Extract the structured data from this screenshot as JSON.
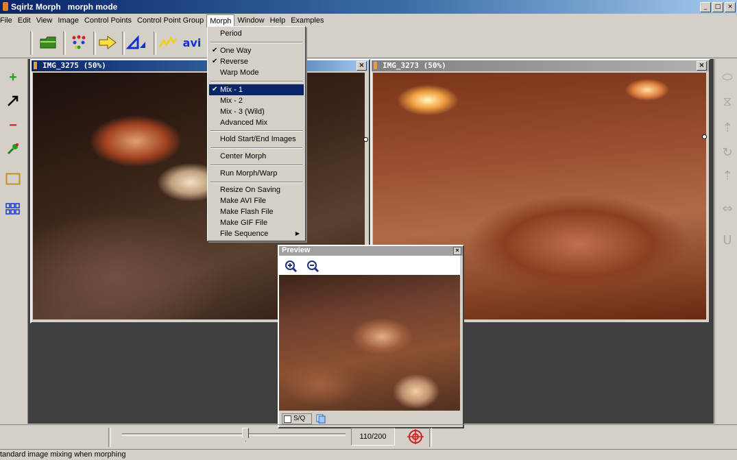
{
  "window": {
    "title": "Sqirlz Morph   morph mode"
  },
  "menubar": [
    "File",
    "Edit",
    "View",
    "Image",
    "Control Points",
    "Control Point Group",
    "Morph",
    "Window",
    "Help",
    "Examples"
  ],
  "morph_menu": {
    "items": [
      {
        "label": "Period",
        "checked": false
      },
      {
        "label": "One Way",
        "checked": true
      },
      {
        "label": "Reverse",
        "checked": true
      },
      {
        "label": "Warp Mode",
        "checked": false
      },
      {
        "label": "Mix - 1",
        "checked": true,
        "selected": true
      },
      {
        "label": "Mix - 2",
        "checked": false
      },
      {
        "label": "Mix - 3 (Wild)",
        "checked": false
      },
      {
        "label": "Advanced Mix",
        "checked": false
      },
      {
        "label": "Hold Start/End Images",
        "checked": false
      },
      {
        "label": "Center Morph",
        "checked": false
      },
      {
        "label": "Run Morph/Warp",
        "checked": false
      },
      {
        "label": "Resize On Saving",
        "checked": false
      },
      {
        "label": "Make AVI File",
        "checked": false
      },
      {
        "label": "Make Flash File",
        "checked": false
      },
      {
        "label": "Make GIF File",
        "checked": false
      },
      {
        "label": "File Sequence",
        "checked": false,
        "submenu": true
      }
    ]
  },
  "toolbar": {
    "avi_label": "avi"
  },
  "image_windows": [
    {
      "title": "IMG_3275 (50%)"
    },
    {
      "title": "IMG_3273 (50%)"
    }
  ],
  "preview": {
    "title": "Preview",
    "sq_label": "S/Q"
  },
  "slider": {
    "frame_label": "110/200",
    "position": 0.55
  },
  "status": {
    "text": "tandard image mixing when morphing"
  }
}
